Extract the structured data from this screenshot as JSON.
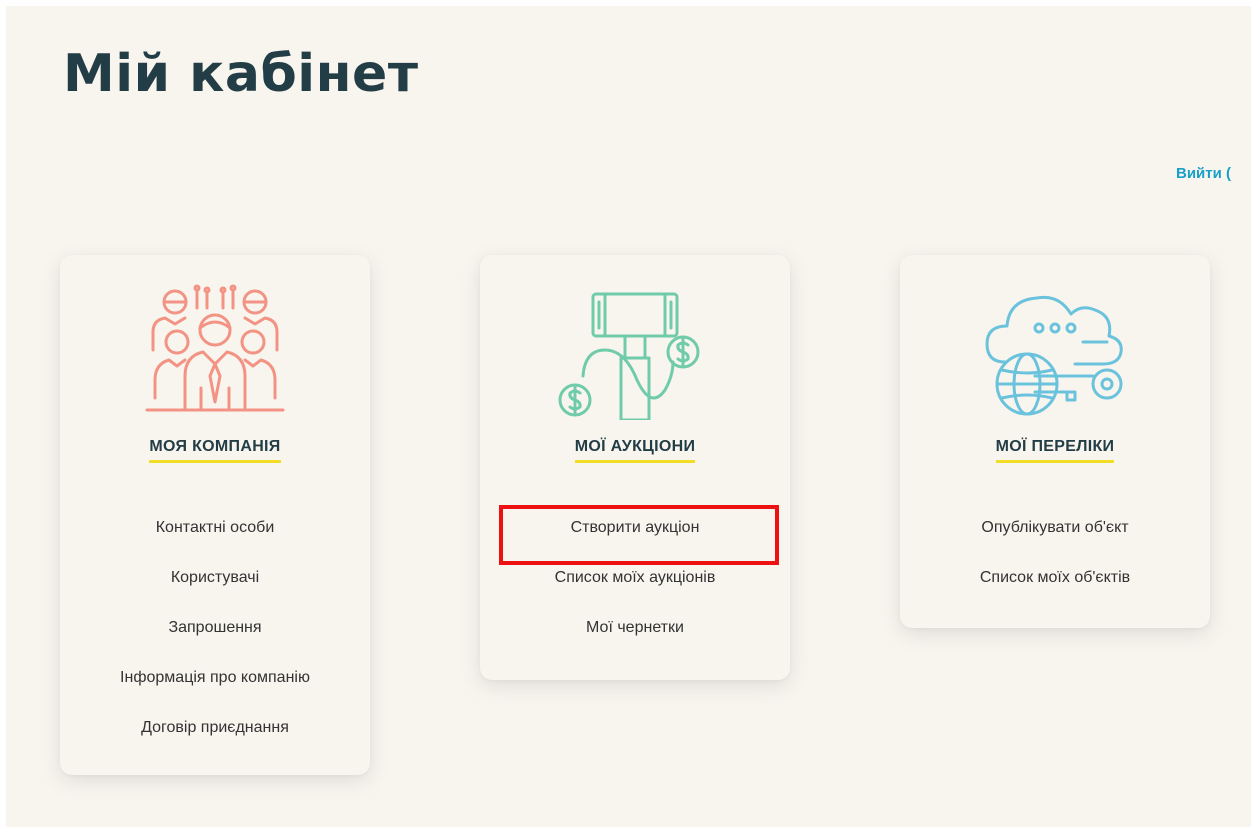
{
  "page": {
    "title": "Мій кабінет",
    "logout_label": "Вийти ("
  },
  "cards": [
    {
      "heading": "МОЯ КОМПАНІЯ",
      "icon": "team-icon",
      "icon_color": "#f39384",
      "links": [
        "Контактні особи",
        "Користувачі",
        "Запрошення",
        "Інформація про компанію",
        "Договір приєднання"
      ]
    },
    {
      "heading": "МОЇ АУКЦІОНИ",
      "icon": "auction-gavel-icon",
      "icon_color": "#6fcba9",
      "links": [
        "Створити аукціон",
        "Список моїх аукціонів",
        "Мої чернетки"
      ]
    },
    {
      "heading": "МОЇ ПЕРЕЛІКИ",
      "icon": "cloud-globe-key-icon",
      "icon_color": "#6bc2dc",
      "links": [
        "Опублікувати об'єкт",
        "Список моїх об'єктів"
      ]
    }
  ],
  "colors": {
    "title": "#233d47",
    "accent_link": "#18a0c8",
    "underline": "#f2dd27",
    "highlight": "#ee1111",
    "background": "#f8f5ef"
  }
}
